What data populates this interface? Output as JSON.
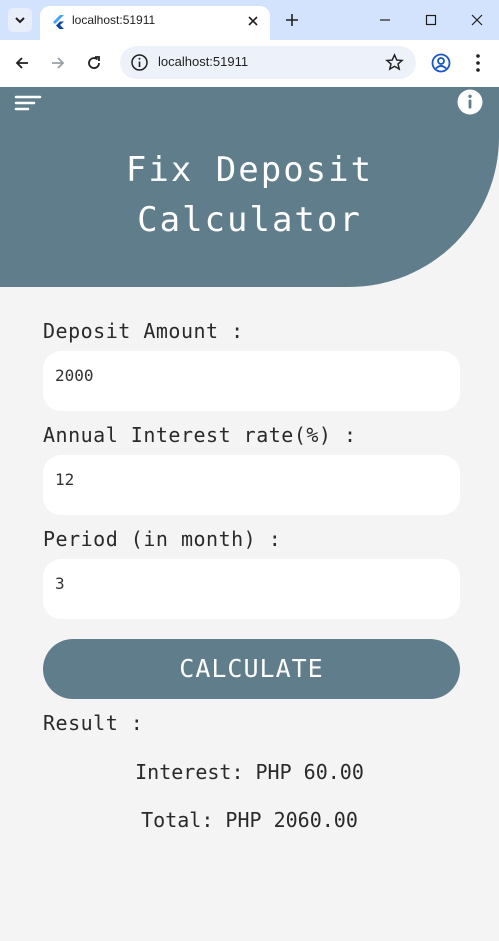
{
  "browser": {
    "tab_title": "localhost:51911",
    "url": "localhost:51911",
    "icons": [
      "tab-search-icon",
      "flutter-icon",
      "close-icon",
      "plus-icon",
      "minimize-icon",
      "maximize-icon",
      "close-icon",
      "back-icon",
      "forward-icon",
      "reload-icon",
      "info-icon",
      "star-icon",
      "profile-icon",
      "kebab-icon"
    ]
  },
  "app": {
    "title_line1": "Fix Deposit",
    "title_line2": "Calculator",
    "header_color": "#607d8b",
    "form": {
      "deposit_label": "Deposit Amount :",
      "deposit_value": "2000",
      "rate_label": "Annual Interest rate(%) :",
      "rate_value": "12",
      "period_label": "Period (in month) :",
      "period_value": "3"
    },
    "calculate_label": "CALCULATE",
    "result": {
      "label": "Result :",
      "interest": "Interest: PHP 60.00",
      "total": "Total: PHP 2060.00"
    }
  }
}
